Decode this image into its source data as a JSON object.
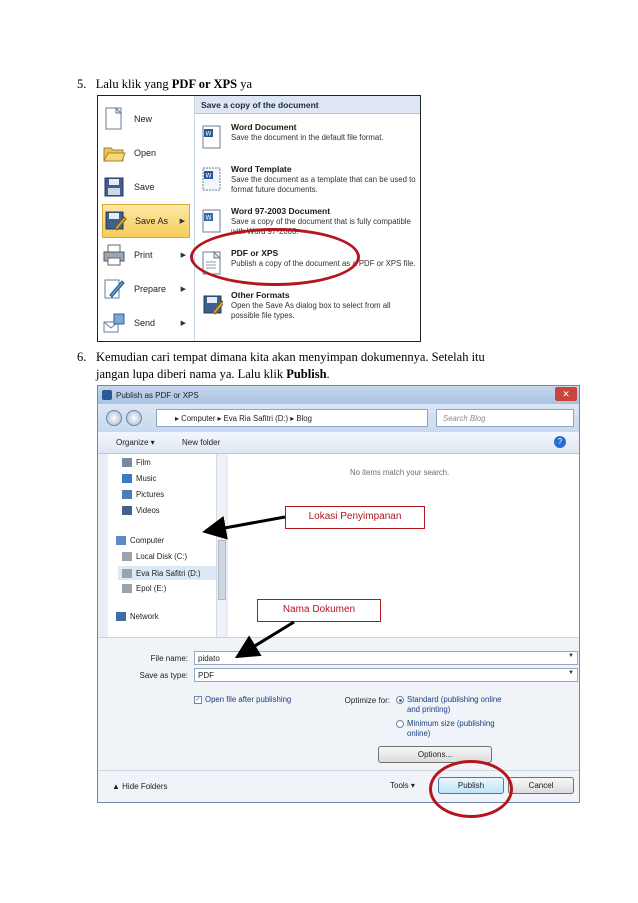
{
  "steps": {
    "five": {
      "num": "5.",
      "pre": "Lalu klik yang ",
      "bold": "PDF or XPS",
      "post": " ya"
    },
    "six": {
      "num": "6.",
      "line1": "Kemudian cari tempat dimana kita akan menyimpan dokumennya. Setelah itu",
      "line2_pre": "jangan lupa diberi nama ya. Lalu klik ",
      "line2_bold": "Publish",
      "line2_post": "."
    }
  },
  "office_menu": {
    "left_items": [
      {
        "label": "New",
        "icon": "new-document-icon"
      },
      {
        "label": "Open",
        "icon": "open-folder-icon"
      },
      {
        "label": "Save",
        "icon": "floppy-disk-icon"
      },
      {
        "label": "Save As",
        "icon": "save-as-icon",
        "selected": true,
        "arrow": "▶"
      },
      {
        "label": "Print",
        "icon": "printer-icon",
        "arrow": "▶"
      },
      {
        "label": "Prepare",
        "icon": "prepare-icon",
        "arrow": "▶"
      },
      {
        "label": "Send",
        "icon": "send-icon",
        "arrow": "▶"
      }
    ],
    "header": "Save a copy of the document",
    "options": [
      {
        "title": "Word Document",
        "desc": "Save the document in the default file format.",
        "icon": "word-document-icon"
      },
      {
        "title": "Word Template",
        "desc": "Save the document as a template that can be used to format future documents.",
        "icon": "word-template-icon"
      },
      {
        "title": "Word 97-2003 Document",
        "desc": "Save a copy of the document that is fully compatible with Word 97-2003.",
        "icon": "word-97-icon"
      },
      {
        "title": "PDF or XPS",
        "desc": "Publish a copy of the document as a PDF or XPS file.",
        "icon": "pdf-xps-icon"
      },
      {
        "title": "Other Formats",
        "desc": "Open the Save As dialog box to select from all possible file types.",
        "icon": "other-formats-icon"
      }
    ]
  },
  "dialog": {
    "title": "Publish as PDF or XPS",
    "breadcrumb": "▸  Computer  ▸  Eva Ria Safitri (D:)  ▸  Blog",
    "search_placeholder": "Search Blog",
    "toolbar": {
      "organize": "Organize ▾",
      "new_folder": "New folder"
    },
    "nav_items": [
      {
        "label": "Film",
        "icon": "film-icon"
      },
      {
        "label": "Music",
        "icon": "music-icon"
      },
      {
        "label": "Pictures",
        "icon": "pictures-icon"
      },
      {
        "label": "Videos",
        "icon": "videos-icon"
      },
      {
        "label": "Computer",
        "icon": "computer-icon"
      },
      {
        "label": "Local Disk (C:)",
        "icon": "drive-icon"
      },
      {
        "label": "Eva Ria Safitri (D:)",
        "icon": "drive-icon"
      },
      {
        "label": "Epol (E:)",
        "icon": "drive-icon"
      },
      {
        "label": "Network",
        "icon": "network-icon"
      }
    ],
    "empty_message": "No items match your search.",
    "file_name_label": "File name:",
    "file_name_value": "pidato",
    "save_type_label": "Save as type:",
    "save_type_value": "PDF",
    "open_after": "Open file after publishing",
    "optimize_label": "Optimize for:",
    "optimize_standard": "Standard (publishing online and printing)",
    "optimize_minimum": "Minimum size (publishing online)",
    "options_button": "Options...",
    "hide_folders": "Hide Folders",
    "tools": "Tools",
    "publish_button": "Publish",
    "cancel_button": "Cancel"
  },
  "callouts": {
    "location": "Lokasi Penyimpanan",
    "name": "Nama Dokumen"
  },
  "colors": {
    "annotation_red": "#b5161d",
    "menu_highlight": "#f7cc5c"
  }
}
